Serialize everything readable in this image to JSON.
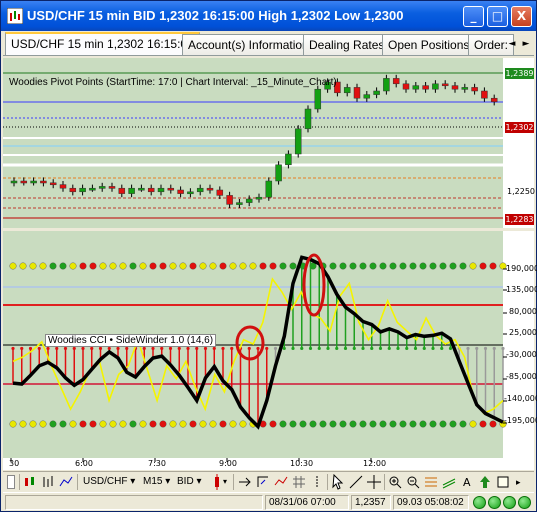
{
  "window": {
    "title": "USD/CHF 15 min BID 1,2302 16:15:00 High 1,2302 Low 1,2300",
    "controls": [
      "_",
      "□",
      "X"
    ]
  },
  "tabs": [
    "USD/CHF 15 min 1,2302 16:15:00",
    "Account(s) Information",
    "Dealing Rates",
    "Open Positions",
    "Order:"
  ],
  "tab_arrows": [
    "◄",
    "►"
  ],
  "upper_panel": {
    "indicator_label": "Woodies Pivot Points (StartTime: 17:0 | Chart Interval: _15_Minute_Chart)",
    "price_axis": [
      "1,2389",
      "1,2302",
      "1,2250",
      "1,2283"
    ],
    "price_tag_colors": {
      "1,2389": "#1e8a1e",
      "1,2302": "#c00000",
      "1,2283": "#c00000"
    }
  },
  "lower_panel": {
    "indicator_label": "Woodies CCI • SideWinder 1.0 (14,6)",
    "cci_axis": [
      "190,000",
      "135,000",
      "80,000",
      "25,000",
      "-30,000",
      "-85,000",
      "-140,000",
      "-195,000"
    ]
  },
  "time_axis": [
    "30",
    "6:00",
    "7:30",
    "9:00",
    "10:30",
    "12:00"
  ],
  "chart_data": {
    "type": "line",
    "title": "USD/CHF 15 min BID",
    "x_ticks": [
      "30",
      "6:00",
      "7:30",
      "9:00",
      "10:30",
      "12:00"
    ],
    "price_candles": {
      "y_ticks": [
        "1,2389",
        "1,2302",
        "1,2250",
        "1,2283"
      ],
      "open": [
        1.2268,
        1.227,
        1.2269,
        1.227,
        1.2268,
        1.2266,
        1.2262,
        1.2258,
        1.2262,
        1.2262,
        1.2264,
        1.2262,
        1.2256,
        1.2262,
        1.2262,
        1.2258,
        1.2262,
        1.226,
        1.2256,
        1.2258,
        1.2262,
        1.226,
        1.2254,
        1.2244,
        1.2246,
        1.225,
        1.2252,
        1.227,
        1.2288,
        1.23,
        1.2328,
        1.235,
        1.2372,
        1.238,
        1.2368,
        1.2374,
        1.2362,
        1.2366,
        1.237,
        1.2384,
        1.2378,
        1.2372,
        1.2376,
        1.2372,
        1.2378,
        1.2376,
        1.2372,
        1.2374,
        1.237,
        1.2362
      ],
      "close": [
        1.227,
        1.2269,
        1.227,
        1.2268,
        1.2266,
        1.2262,
        1.2258,
        1.2262,
        1.2262,
        1.2264,
        1.2262,
        1.2256,
        1.2262,
        1.2262,
        1.2258,
        1.2262,
        1.226,
        1.2256,
        1.2258,
        1.2262,
        1.226,
        1.2254,
        1.2244,
        1.2246,
        1.225,
        1.2252,
        1.227,
        1.2288,
        1.23,
        1.2328,
        1.235,
        1.2372,
        1.238,
        1.2368,
        1.2374,
        1.2362,
        1.2366,
        1.237,
        1.2384,
        1.2378,
        1.2372,
        1.2376,
        1.2372,
        1.2378,
        1.2376,
        1.2372,
        1.2374,
        1.237,
        1.2362,
        1.2358
      ]
    },
    "cci": {
      "ylim": [
        -195,
        190
      ],
      "series": [
        {
          "values": [
            -80,
            -82,
            -62,
            -40,
            -32,
            -45,
            -68,
            -85,
            -72,
            -48,
            -25,
            -8,
            -22,
            -55,
            -66,
            -42,
            -22,
            -18,
            -38,
            -62,
            -90,
            -120,
            -68,
            -42,
            -75,
            -95,
            -135,
            -160,
            -180,
            -120,
            -40,
            28,
            150,
            210,
            205,
            195,
            165,
            125,
            95,
            80,
            62,
            55,
            38,
            45,
            38,
            25,
            32,
            28,
            30,
            35,
            22,
            -30,
            -80,
            -130,
            -150,
            -160,
            -170
          ]
        },
        {
          "values": [
            -30,
            -20,
            -5,
            15,
            -40,
            -90,
            -140,
            -100,
            -50,
            -30,
            -120,
            -60,
            -40,
            20,
            -50,
            -120,
            -40,
            -70,
            -30,
            -90,
            -140,
            -60,
            -100,
            -30,
            20,
            10,
            60,
            160,
            130,
            90,
            130,
            80,
            70,
            40,
            120,
            150,
            60,
            20,
            50,
            110,
            60,
            40,
            20,
            70,
            30,
            10,
            20,
            -20,
            -120,
            -150,
            -140,
            -120
          ]
        }
      ],
      "zero_line": 0,
      "levels": [
        100,
        -100
      ]
    }
  },
  "toolbar": {
    "symbol": "USD/CHF ▾",
    "interval": "M15 ▾",
    "side": "BID ▾"
  },
  "status": {
    "date_time": "08/31/06 07:00",
    "price": "1,2357",
    "clock": "09.03 05:08:02"
  }
}
